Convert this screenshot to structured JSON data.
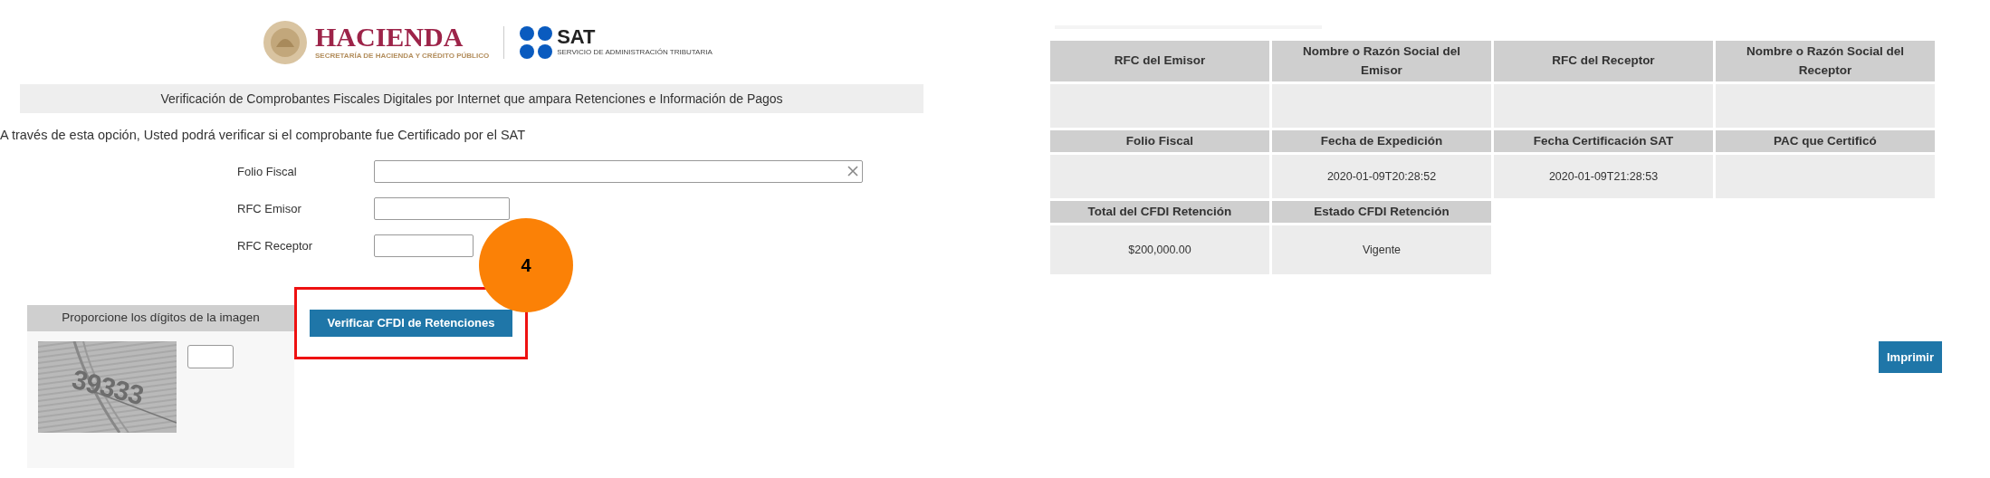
{
  "logo": {
    "hacienda": "HACIENDA",
    "hacienda_subtitle": "SECRETARÍA DE HACIENDA Y CRÉDITO PÚBLICO",
    "sat": "SAT",
    "sat_subtitle": "SERVICIO DE ADMINISTRACIÓN TRIBUTARIA"
  },
  "section_title": "Verificación de Comprobantes Fiscales Digitales por Internet que ampara Retenciones e Información de Pagos",
  "intro": "A través de esta opción, Usted podrá verificar si el comprobante fue Certificado por el SAT",
  "fields": [
    {
      "label": "Folio Fiscal",
      "kind": "wide"
    },
    {
      "label": "RFC Emisor",
      "kind": "short"
    },
    {
      "label": "RFC Receptor",
      "kind": "partial"
    }
  ],
  "captcha": {
    "title": "Proporcione los dígitos de la imagen",
    "text": "39333"
  },
  "verify_button": "Verificar CFDI de Retenciones",
  "step_badge": "4",
  "results": [
    {
      "cells": [
        {
          "header": "RFC del Emisor"
        },
        {
          "header": "Nombre o Razón Social del Emisor"
        },
        {
          "header": "RFC del Receptor"
        },
        {
          "header": "Nombre o Razón Social del Receptor"
        }
      ]
    },
    {
      "cells": [
        {
          "header": "Folio Fiscal"
        },
        {
          "header": "Fecha de Expedición",
          "value": "2020-01-09T20:28:52"
        },
        {
          "header": "Fecha Certificación SAT",
          "value": "2020-01-09T21:28:53"
        },
        {
          "header": "PAC que Certificó"
        }
      ]
    },
    {
      "cells": [
        {
          "header": "Total del CFDI Retención",
          "value": "$200,000.00"
        },
        {
          "header": "Estado CFDI Retención",
          "value": "Vigente"
        }
      ]
    }
  ],
  "print_button": "Imprimir"
}
